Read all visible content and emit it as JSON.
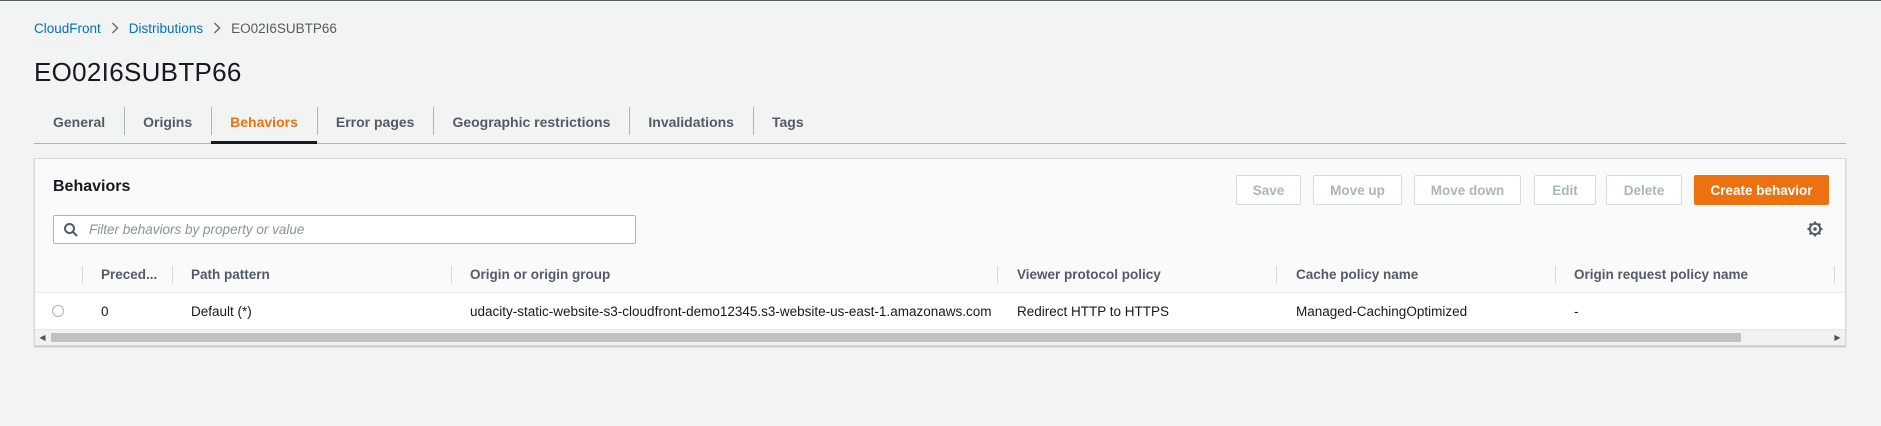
{
  "breadcrumb": {
    "items": [
      "CloudFront",
      "Distributions"
    ],
    "current": "EO02I6SUBTP66"
  },
  "page": {
    "title": "EO02I6SUBTP66"
  },
  "tabs": [
    {
      "label": "General"
    },
    {
      "label": "Origins"
    },
    {
      "label": "Behaviors",
      "active": true
    },
    {
      "label": "Error pages"
    },
    {
      "label": "Geographic restrictions"
    },
    {
      "label": "Invalidations"
    },
    {
      "label": "Tags"
    }
  ],
  "panel": {
    "title": "Behaviors",
    "buttons": {
      "save": "Save",
      "move_up": "Move up",
      "move_down": "Move down",
      "edit": "Edit",
      "delete": "Delete",
      "create": "Create behavior"
    },
    "filter_placeholder": "Filter behaviors by property or value"
  },
  "table": {
    "columns": [
      "Preced...",
      "Path pattern",
      "Origin or origin group",
      "Viewer protocol policy",
      "Cache policy name",
      "Origin request policy name"
    ],
    "rows": [
      {
        "precedence": "0",
        "path_pattern": "Default (*)",
        "origin": "udacity-static-website-s3-cloudfront-demo12345.s3-website-us-east-1.amazonaws.com",
        "viewer_protocol": "Redirect HTTP to HTTPS",
        "cache_policy": "Managed-CachingOptimized",
        "origin_request_policy": "-"
      }
    ]
  },
  "colors": {
    "accent": "#ec7211",
    "link": "#0073bb",
    "background": "#f2f3f3"
  }
}
